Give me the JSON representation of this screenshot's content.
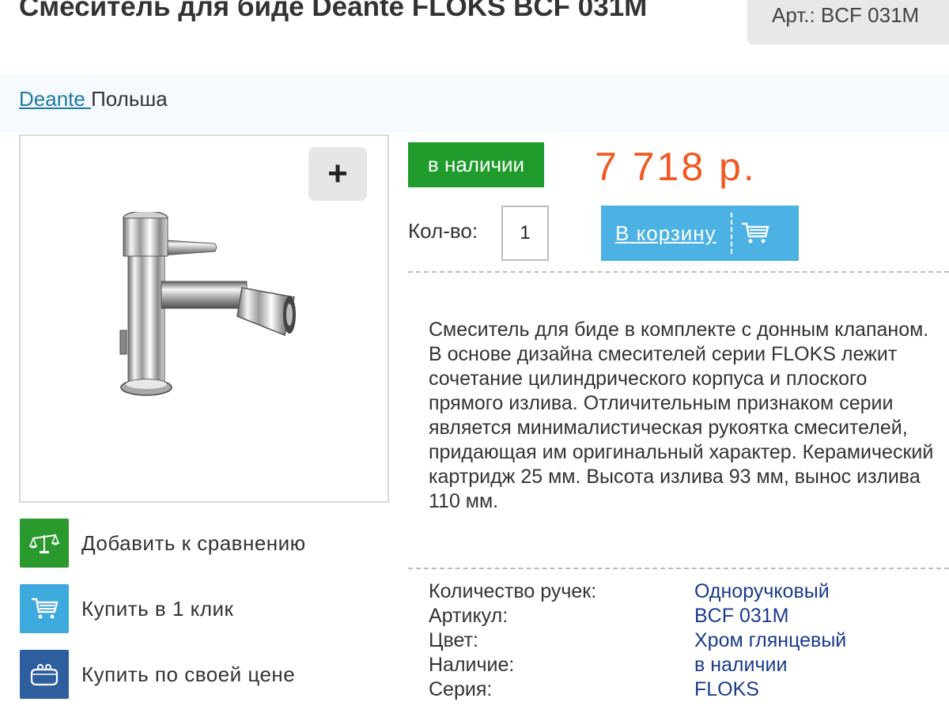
{
  "page": {
    "title": "Смеситель для биде Deante FLOKS BCF 031M",
    "article": "Арт.: BCF 031M",
    "brand": {
      "name": "Deante ",
      "country": "Польша"
    }
  },
  "gallery": {
    "zoom_label": "+"
  },
  "buy": {
    "stock_badge": "в наличии",
    "price": "7 718 р.",
    "qty_label": "Кол-во:",
    "qty_value": "1",
    "cart_label": "В корзину"
  },
  "actions": [
    {
      "label": "Добавить к сравнению",
      "icon": "scales-icon",
      "color": "#2a9a2e"
    },
    {
      "label": "Купить в 1 клик",
      "icon": "cart-icon",
      "color": "#3ea9dd"
    },
    {
      "label": "Купить по своей цене",
      "icon": "purse-icon",
      "color": "#2d5e9e"
    }
  ],
  "description": "Смеситель для биде в комплекте с донным клапаном. В основе дизайна смесителей серии FLOKS лежит сочетание цилиндрического корпуса и плоского прямого излива. Отличительным признаком серии является минималистическая рукоятка смесителей, придающая им оригинальный характер. Керамический картридж 25 мм. Высота излива 93 мм, вынос излива 110 мм.",
  "specs": [
    {
      "label": "Количество ручек:",
      "value": "Одноручковый"
    },
    {
      "label": "Артикул:",
      "value": "BCF 031M"
    },
    {
      "label": "Цвет:",
      "value": "Хром глянцевый"
    },
    {
      "label": "Наличие:",
      "value": "в наличии"
    },
    {
      "label": "Серия:",
      "value": "FLOKS"
    }
  ],
  "colors": {
    "price": "#f05a22",
    "stock_green": "#1f9c2c",
    "cart_blue": "#4bb2e3",
    "spec_value": "#1a3a8c",
    "brand_link": "#1d7aa3"
  }
}
